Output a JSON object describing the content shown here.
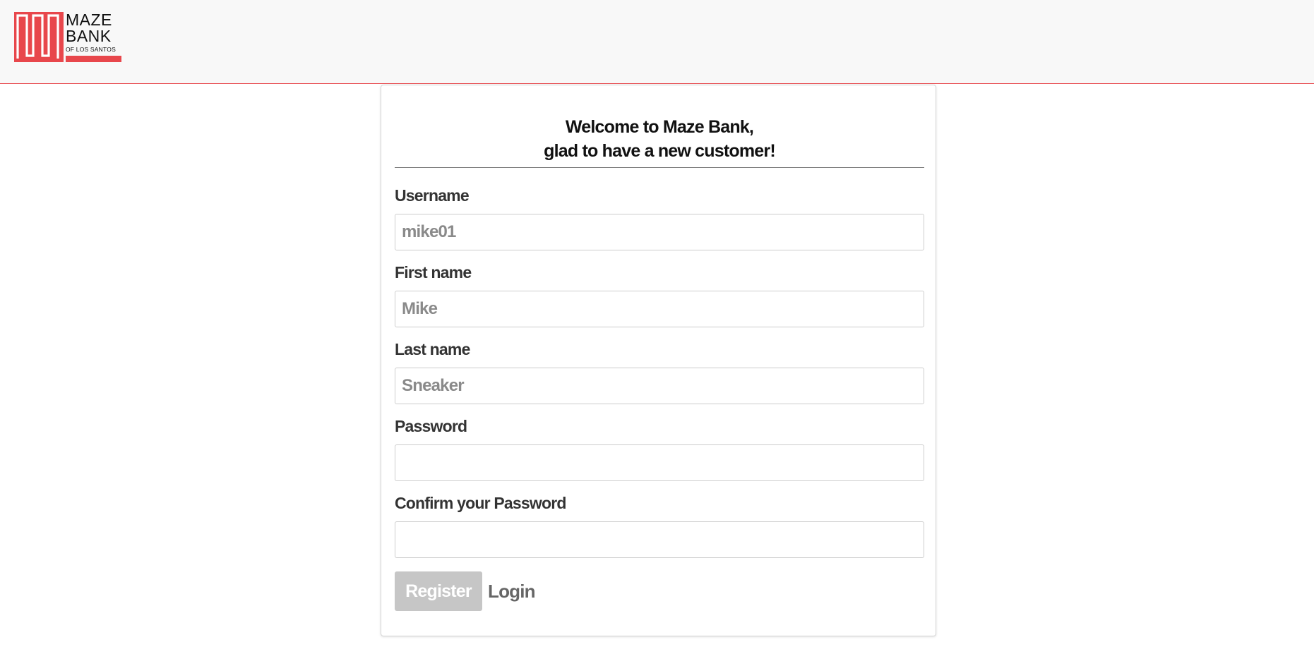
{
  "brand": {
    "line1": "MAZE",
    "line2": "BANK",
    "tagline": "OF LOS SANTOS",
    "accent_color": "#e8474c",
    "icon": "maze-logo-icon"
  },
  "form": {
    "title_line1": "Welcome to Maze Bank,",
    "title_line2": "glad to have a new customer!",
    "fields": [
      {
        "label": "Username",
        "placeholder": "mike01",
        "value": ""
      },
      {
        "label": "First name",
        "placeholder": "Mike",
        "value": ""
      },
      {
        "label": "Last name",
        "placeholder": "Sneaker",
        "value": ""
      },
      {
        "label": "Password",
        "placeholder": "",
        "value": ""
      },
      {
        "label": "Confirm your Password",
        "placeholder": "",
        "value": ""
      }
    ],
    "register_label": "Register",
    "login_label": "Login"
  }
}
